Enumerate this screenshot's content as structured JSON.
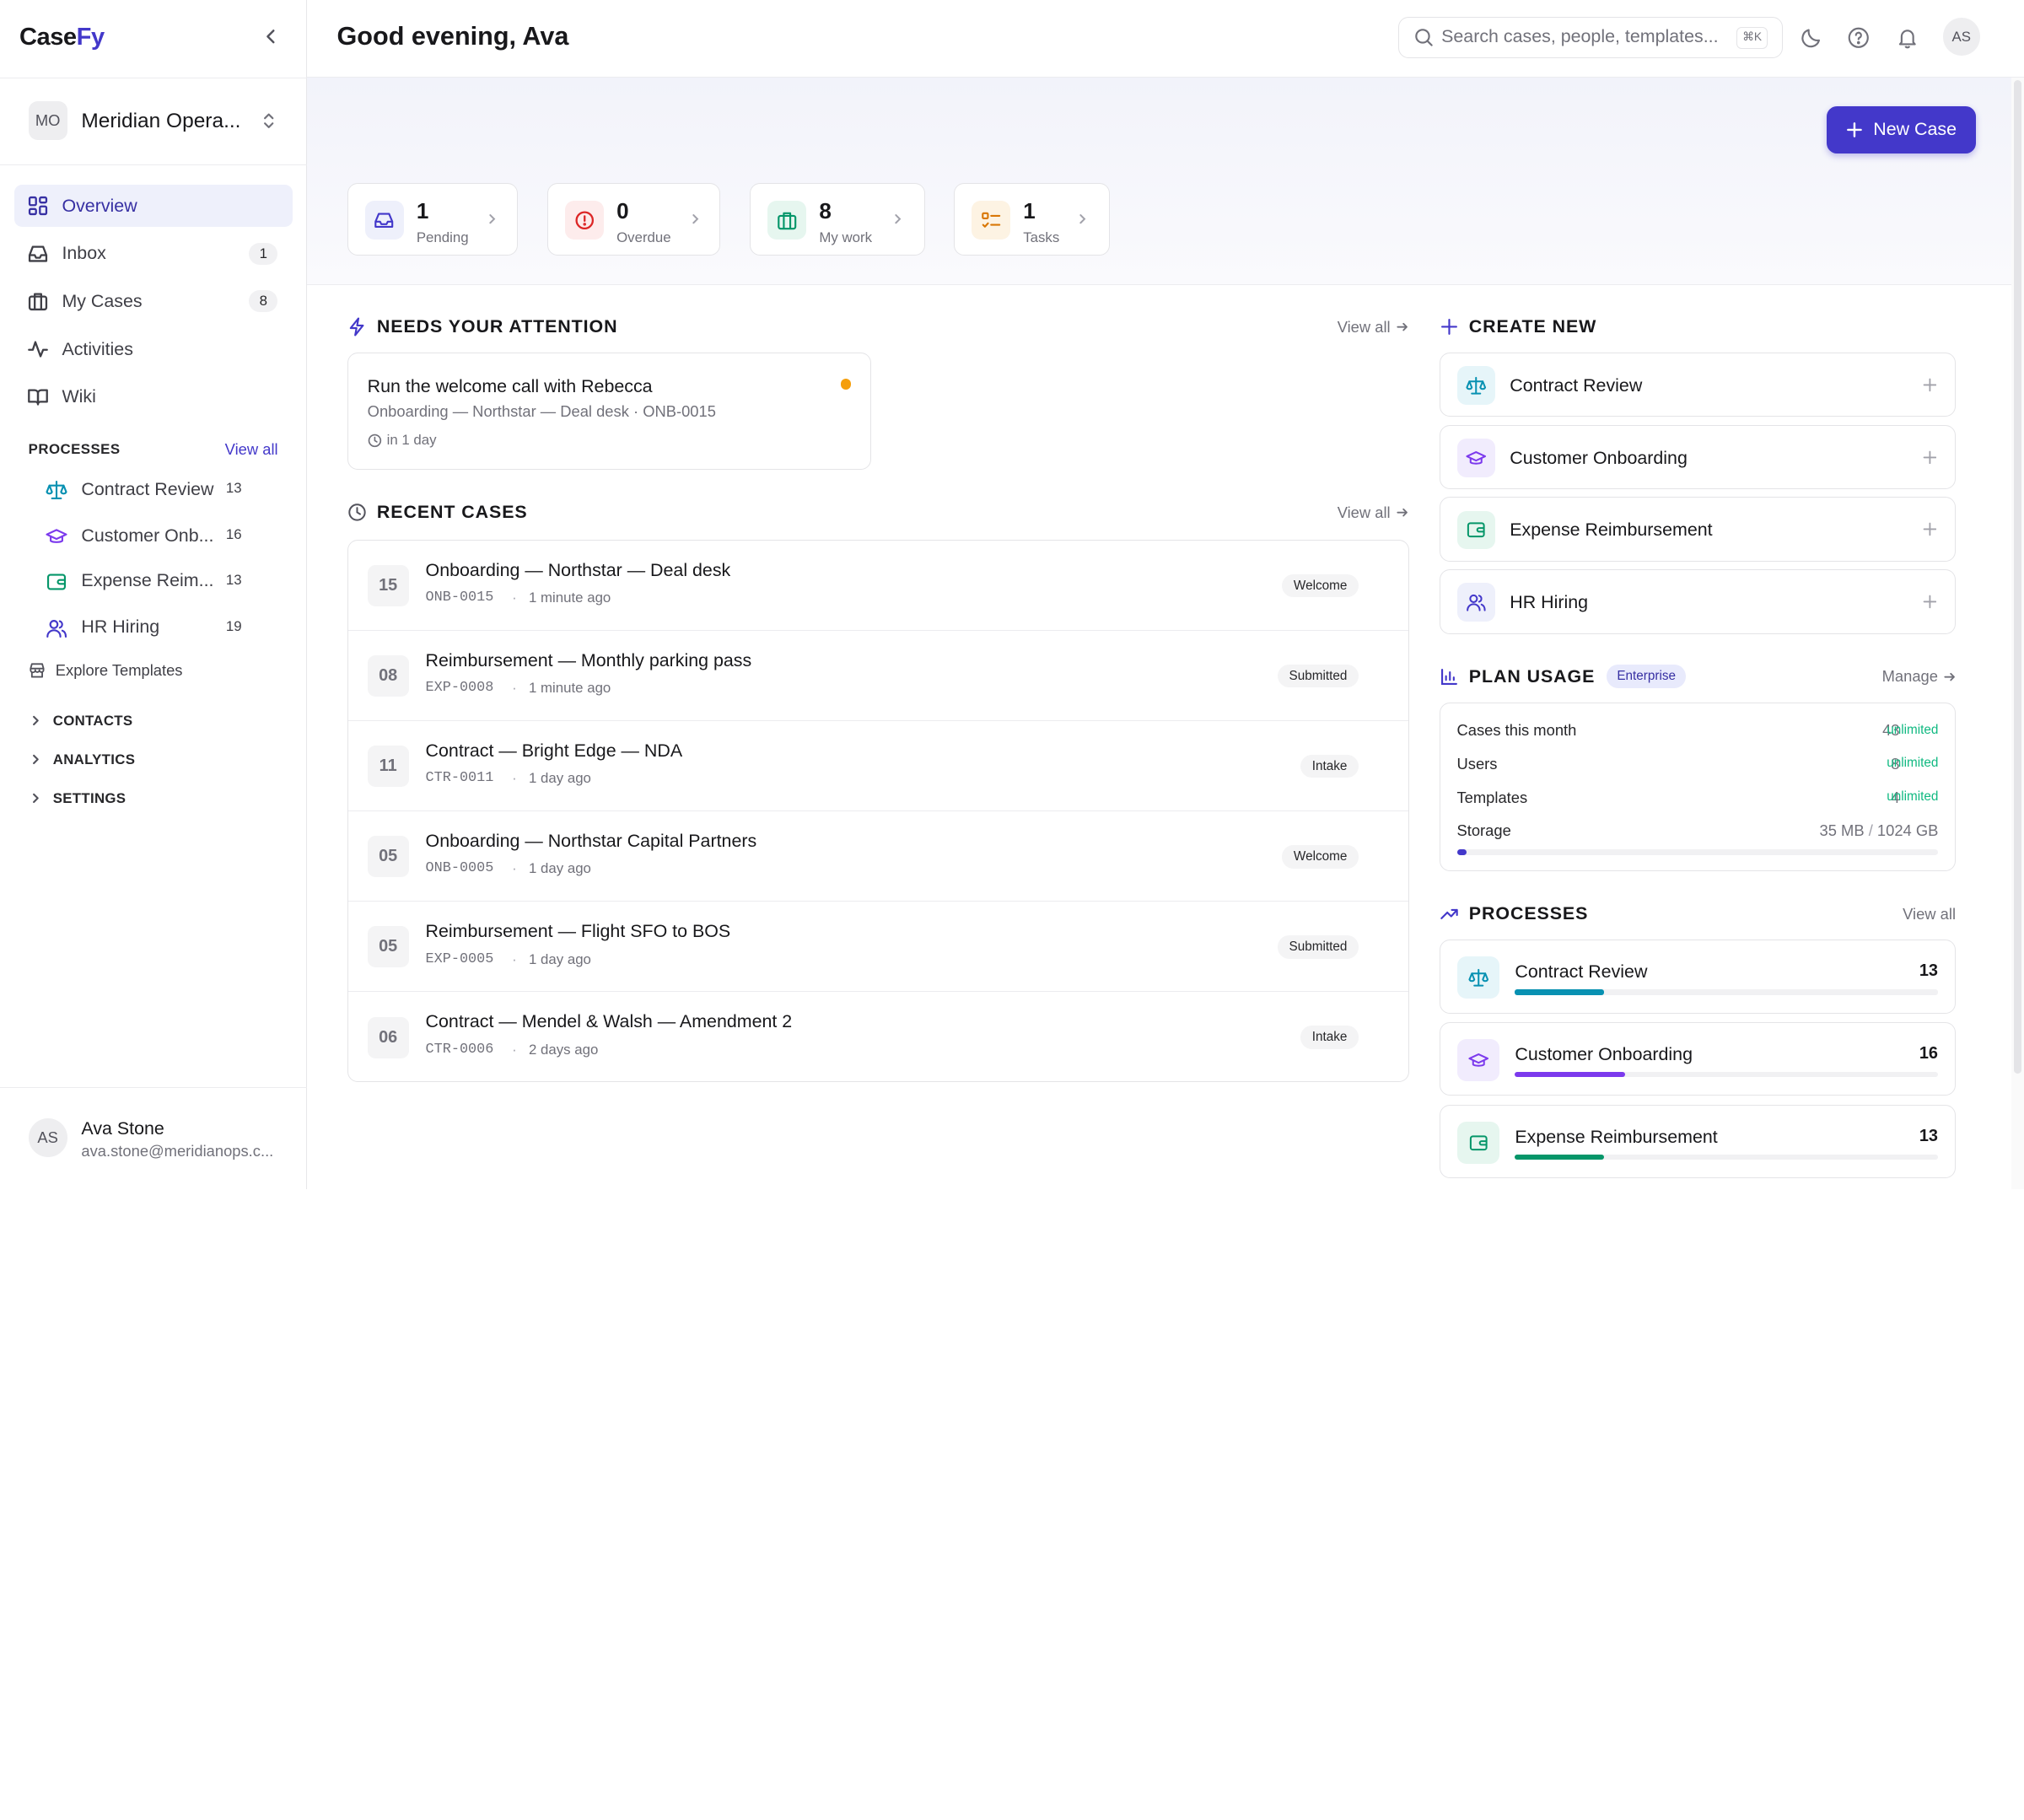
{
  "app": {
    "logo_a": "Case",
    "logo_b": "Fy"
  },
  "org": {
    "initials": "MO",
    "name": "Meridian Opera..."
  },
  "nav": [
    {
      "label": "Overview",
      "icon": "grid-icon",
      "active": true
    },
    {
      "label": "Inbox",
      "icon": "inbox-icon",
      "count": "1"
    },
    {
      "label": "My Cases",
      "icon": "briefcase-icon",
      "count": "8"
    },
    {
      "label": "Activities",
      "icon": "activity-icon"
    },
    {
      "label": "Wiki",
      "icon": "book-icon"
    }
  ],
  "sidebar_processes": {
    "heading": "PROCESSES",
    "view_all": "View all",
    "items": [
      {
        "label": "Contract Review",
        "count": "13",
        "icon": "scale-icon",
        "color": "#0891b2"
      },
      {
        "label": "Customer Onb...",
        "count": "16",
        "icon": "graduation-cap-icon",
        "color": "#7c3aed"
      },
      {
        "label": "Expense Reim...",
        "count": "13",
        "icon": "wallet-icon",
        "color": "#059669"
      },
      {
        "label": "HR Hiring",
        "count": "19",
        "icon": "users-icon",
        "color": "#4338ca"
      }
    ]
  },
  "explore": "Explore Templates",
  "collapsibles": [
    "CONTACTS",
    "ANALYTICS",
    "SETTINGS"
  ],
  "user": {
    "initials": "AS",
    "name": "Ava Stone",
    "email": "ava.stone@meridianops.c..."
  },
  "topbar": {
    "greeting": "Good evening, Ava",
    "search_placeholder": "Search cases, people, templates...",
    "shortcut": "⌘K",
    "avatar": "AS"
  },
  "new_case": "New Case",
  "stats": [
    {
      "value": "1",
      "label": "Pending",
      "icon": "inbox-icon",
      "bg": "#eef0fb",
      "fg": "#4338ca"
    },
    {
      "value": "0",
      "label": "Overdue",
      "icon": "alert-circle-icon",
      "bg": "#fdecec",
      "fg": "#dc2626"
    },
    {
      "value": "8",
      "label": "My work",
      "icon": "briefcase-icon",
      "bg": "#e6f6ef",
      "fg": "#059669"
    },
    {
      "value": "1",
      "label": "Tasks",
      "icon": "checklist-icon",
      "bg": "#fdf3e3",
      "fg": "#d97706"
    }
  ],
  "attention": {
    "heading": "NEEDS YOUR ATTENTION",
    "view_all": "View all",
    "card": {
      "title": "Run the welcome call with Rebecca",
      "subtitle": "Onboarding — Northstar — Deal desk · ONB-0015",
      "due": "in 1 day"
    }
  },
  "recent": {
    "heading": "RECENT CASES",
    "view_all": "View all",
    "rows": [
      {
        "num": "15",
        "title": "Onboarding — Northstar — Deal desk",
        "code": "ONB-0015",
        "sep": "·",
        "when": "1 minute ago",
        "badge": "Welcome"
      },
      {
        "num": "08",
        "title": "Reimbursement — Monthly parking pass",
        "code": "EXP-0008",
        "sep": "·",
        "when": "1 minute ago",
        "badge": "Submitted"
      },
      {
        "num": "11",
        "title": "Contract — Bright Edge — NDA",
        "code": "CTR-0011",
        "sep": "·",
        "when": "1 day ago",
        "badge": "Intake"
      },
      {
        "num": "05",
        "title": "Onboarding — Northstar Capital Partners",
        "code": "ONB-0005",
        "sep": "·",
        "when": "1 day ago",
        "badge": "Welcome"
      },
      {
        "num": "05",
        "title": "Reimbursement — Flight SFO to BOS",
        "code": "EXP-0005",
        "sep": "·",
        "when": "1 day ago",
        "badge": "Submitted"
      },
      {
        "num": "06",
        "title": "Contract — Mendel & Walsh — Amendment 2",
        "code": "CTR-0006",
        "sep": "·",
        "when": "2 days ago",
        "badge": "Intake"
      }
    ]
  },
  "create_new": {
    "heading": "CREATE NEW",
    "items": [
      {
        "label": "Contract Review",
        "icon": "scale-icon",
        "bg": "#e6f5f9",
        "fg": "#0891b2"
      },
      {
        "label": "Customer Onboarding",
        "icon": "graduation-cap-icon",
        "bg": "#f1ecfd",
        "fg": "#7c3aed"
      },
      {
        "label": "Expense Reimbursement",
        "icon": "wallet-icon",
        "bg": "#e6f6ef",
        "fg": "#059669"
      },
      {
        "label": "HR Hiring",
        "icon": "users-icon",
        "bg": "#eef0fb",
        "fg": "#4338ca"
      }
    ]
  },
  "plan": {
    "heading": "PLAN USAGE",
    "badge": "Enterprise",
    "manage": "Manage",
    "rows": [
      {
        "label": "Cases this month",
        "value": "43",
        "unit": "unlimited"
      },
      {
        "label": "Users",
        "value": "8",
        "unit": "unlimited"
      },
      {
        "label": "Templates",
        "value": "4",
        "unit": "unlimited"
      }
    ],
    "storage": {
      "label": "Storage",
      "used": "35 MB",
      "sep": "/",
      "total": "1024 GB",
      "fraction": 0.02
    }
  },
  "processes": {
    "heading": "PROCESSES",
    "view_all": "View all",
    "items": [
      {
        "label": "Contract Review",
        "count": "13",
        "icon": "scale-icon",
        "bg": "#e6f5f9",
        "fg": "#0891b2",
        "fill": 0.21
      },
      {
        "label": "Customer Onboarding",
        "count": "16",
        "icon": "graduation-cap-icon",
        "bg": "#f1ecfd",
        "fg": "#7c3aed",
        "fill": 0.26
      },
      {
        "label": "Expense Reimbursement",
        "count": "13",
        "icon": "wallet-icon",
        "bg": "#e6f6ef",
        "fg": "#059669",
        "fill": 0.21
      }
    ]
  }
}
